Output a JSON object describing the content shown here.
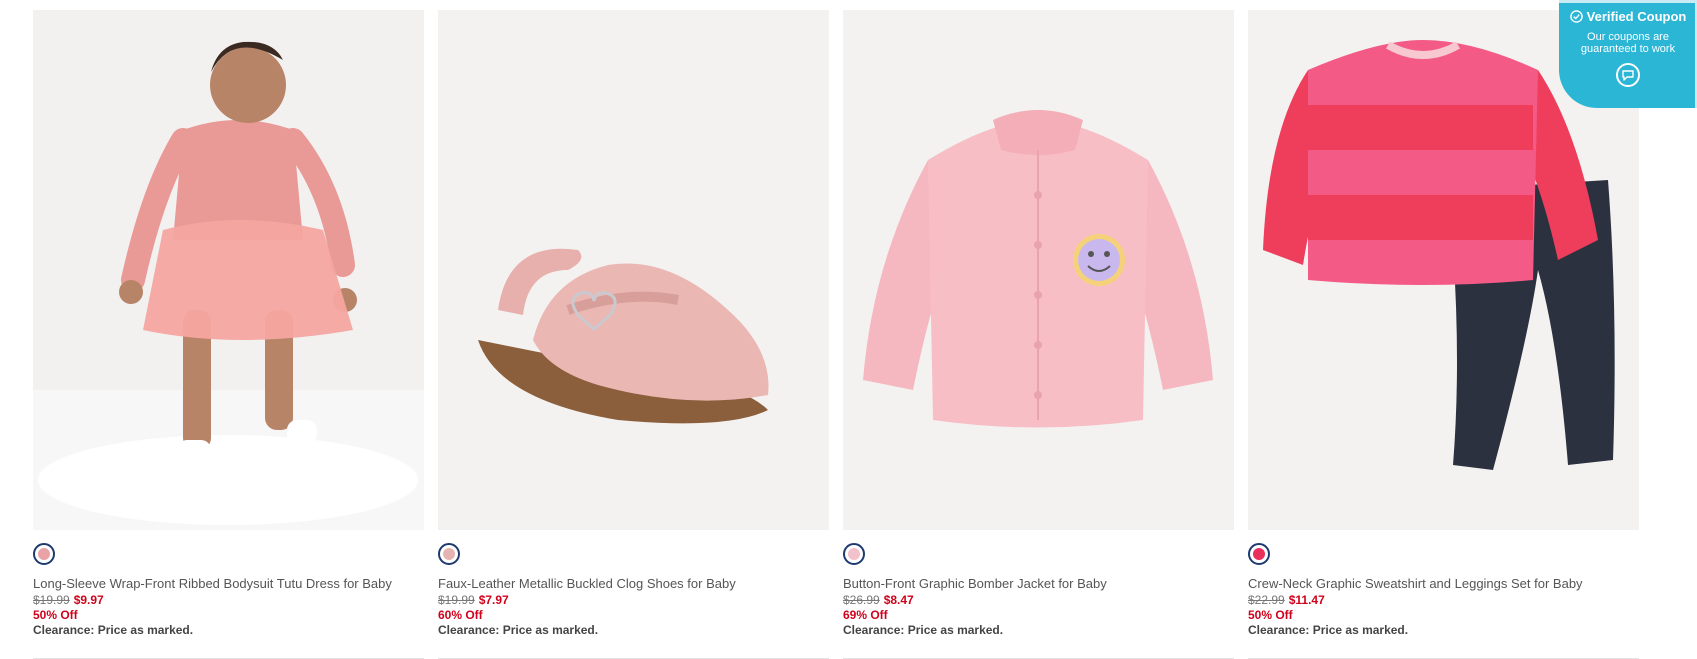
{
  "products": [
    {
      "title": "Long-Sleeve Wrap-Front Ribbed Bodysuit Tutu Dress for Baby",
      "old_price": "$19.99",
      "new_price": "$9.97",
      "discount": "50% Off",
      "note": "Clearance: Price as marked.",
      "swatch_color": "#e9a3a6"
    },
    {
      "title": "Faux-Leather Metallic Buckled Clog Shoes for Baby",
      "old_price": "$19.99",
      "new_price": "$7.97",
      "discount": "60% Off",
      "note": "Clearance: Price as marked.",
      "swatch_color": "#e6b4b0"
    },
    {
      "title": "Button-Front Graphic Bomber Jacket for Baby",
      "old_price": "$26.99",
      "new_price": "$8.47",
      "discount": "69% Off",
      "note": "Clearance: Price as marked.",
      "swatch_color": "#f3c1cc"
    },
    {
      "title": "Crew-Neck Graphic Sweatshirt and Leggings Set for Baby",
      "old_price": "$22.99",
      "new_price": "$11.47",
      "discount": "50% Off",
      "note": "Clearance: Price as marked.",
      "swatch_color": "#e8305a"
    }
  ],
  "coupon": {
    "title": "Verified Coupon",
    "subtitle": "Our coupons are guaranteed to work",
    "check_icon": "check-circle-icon",
    "chat_icon": "chat-bubble-icon",
    "background": "#2bb6d6"
  },
  "colors": {
    "sale_red": "#d0021b",
    "swatch_ring": "#1f3a6e"
  }
}
